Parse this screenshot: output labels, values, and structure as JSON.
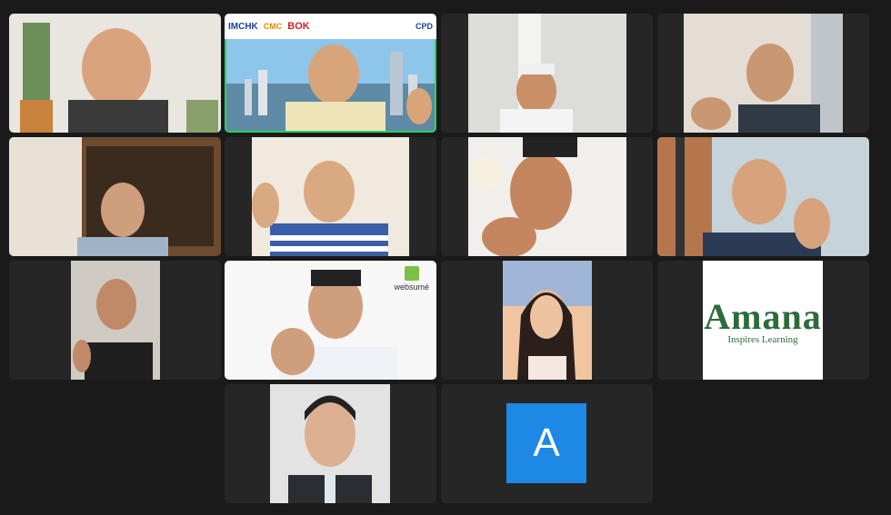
{
  "meeting": {
    "view": "gallery"
  },
  "tiles": [
    {
      "name": "participant-tile-1",
      "kind": "video"
    },
    {
      "name": "participant-tile-2",
      "kind": "video",
      "speaking": true,
      "banner": {
        "imchk": "IMCHK",
        "cmc": "CMC",
        "bok": "BOK",
        "cpd": "CPD"
      }
    },
    {
      "name": "participant-tile-3",
      "kind": "video"
    },
    {
      "name": "participant-tile-4",
      "kind": "video"
    },
    {
      "name": "participant-tile-5",
      "kind": "video"
    },
    {
      "name": "participant-tile-6",
      "kind": "video"
    },
    {
      "name": "participant-tile-7",
      "kind": "video"
    },
    {
      "name": "participant-tile-8",
      "kind": "video"
    },
    {
      "name": "participant-tile-9",
      "kind": "video"
    },
    {
      "name": "participant-tile-10",
      "kind": "video",
      "logo_text": "websumé"
    },
    {
      "name": "participant-tile-11",
      "kind": "video"
    },
    {
      "name": "participant-tile-12",
      "kind": "logo",
      "logo_word": "Amana",
      "logo_tagline": "Inspires Learning"
    },
    {
      "name": "participant-tile-13",
      "kind": "video"
    },
    {
      "name": "participant-tile-14",
      "kind": "avatar",
      "initial": "A",
      "avatar_color": "#1e88e5"
    }
  ],
  "colors": {
    "background": "#1a1a1a",
    "tile": "#262626",
    "active_speaker_border": "#2bd15f"
  }
}
